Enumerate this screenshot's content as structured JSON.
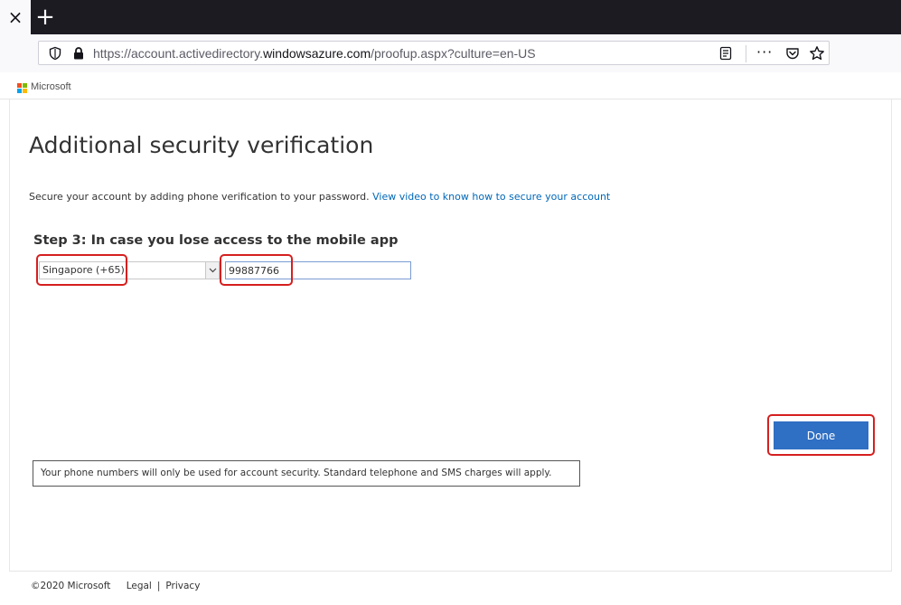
{
  "browser": {
    "tab_close_glyph": "×",
    "new_tab_glyph": "+",
    "url_prefix": "https://account.activedirectory.",
    "url_host": "windowsazure.com",
    "url_suffix": "/proofup.aspx?culture=en-US",
    "more_glyph": "···"
  },
  "header": {
    "brand": "Microsoft",
    "logo_colors": [
      "#f25022",
      "#7fba00",
      "#00a4ef",
      "#ffb900"
    ]
  },
  "main": {
    "title": "Additional security verification",
    "intro_text": "Secure your account by adding phone verification to your password.",
    "intro_link": "View video to know how to secure your account",
    "step_heading": "Step 3: In case you lose access to the mobile app",
    "country_select": {
      "selected": "Singapore (+65)"
    },
    "phone_input": {
      "value": "99887766"
    },
    "done_label": "Done",
    "notice": "Your phone numbers will only be used for account security. Standard telephone and SMS charges will apply."
  },
  "footer": {
    "copyright": "©2020 Microsoft",
    "legal": "Legal",
    "separator": "|",
    "privacy": "Privacy"
  },
  "colors": {
    "accent": "#2f6fc4",
    "link": "#0067b8",
    "highlight": "#d61f1f",
    "tabbar": "#1c1b22"
  }
}
